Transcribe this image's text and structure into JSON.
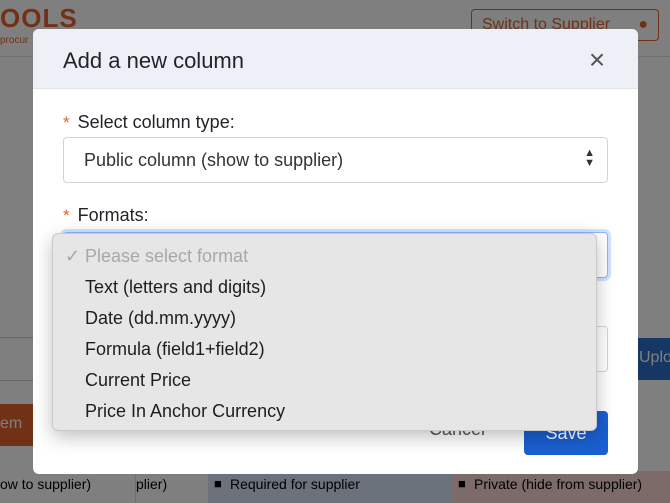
{
  "background": {
    "logo_text": "OOLS",
    "logo_subtext": "procur",
    "switch_button_label": "Switch to Supplier",
    "left_button_label": "em",
    "right_button_label": "Uploa",
    "table_row": [
      "ow to supplier)",
      "plier)",
      "Required for supplier",
      "Private (hide from supplier)"
    ]
  },
  "modal": {
    "title": "Add a new column",
    "close_icon": "×",
    "column_type": {
      "label": "Select column type:",
      "required_mark": "*",
      "selected": "Public column (show to supplier)"
    },
    "formats": {
      "label": "Formats:",
      "required_mark": "*",
      "selected": "Please select format",
      "options": [
        "Please select format",
        "Text (letters and digits)",
        "Date (dd.mm.yyyy)",
        "Formula (field1+field2)",
        "Current Price",
        "Price In Anchor Currency"
      ]
    },
    "cancel_label": "Cancel",
    "save_label": "Save"
  },
  "colors": {
    "brand_orange": "#e0622f",
    "primary_blue": "#1a5fd0",
    "header_bg": "#edf1f7"
  }
}
